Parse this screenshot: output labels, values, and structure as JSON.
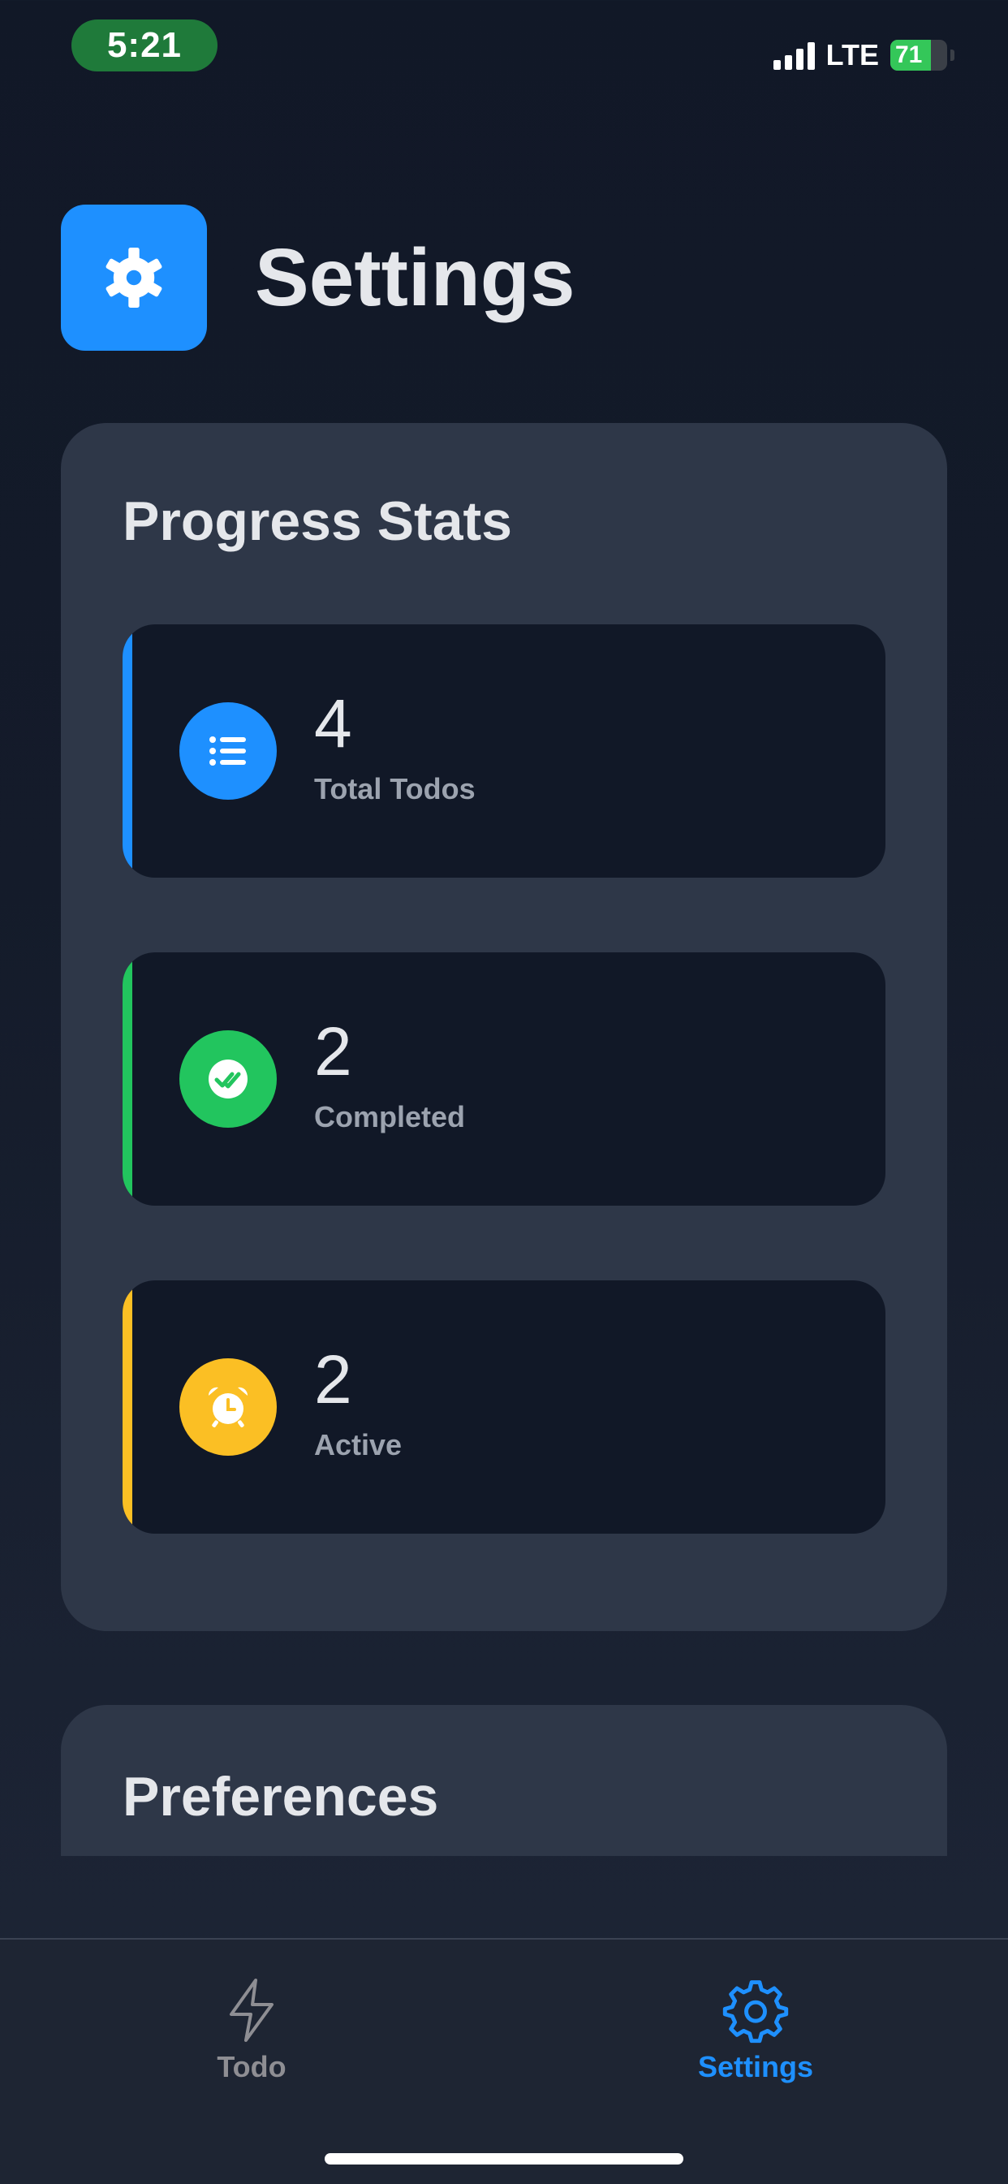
{
  "status_bar": {
    "time": "5:21",
    "network": "LTE",
    "battery": "71",
    "battery_level": 0.71
  },
  "header": {
    "title": "Settings",
    "icon": "gear-icon"
  },
  "progress_stats": {
    "title": "Progress Stats",
    "items": [
      {
        "value": "4",
        "label": "Total Todos",
        "icon": "list-icon",
        "color": "#1e90ff"
      },
      {
        "value": "2",
        "label": "Completed",
        "icon": "double-check-icon",
        "color": "#22c55e"
      },
      {
        "value": "2",
        "label": "Active",
        "icon": "alarm-clock-icon",
        "color": "#fbbf24"
      }
    ]
  },
  "preferences": {
    "title": "Preferences"
  },
  "tabbar": {
    "tabs": [
      {
        "label": "Todo",
        "icon": "lightning-icon",
        "active": false,
        "color": "#8e8e93"
      },
      {
        "label": "Settings",
        "icon": "gear-icon",
        "active": true,
        "color": "#1e90ff"
      }
    ]
  }
}
